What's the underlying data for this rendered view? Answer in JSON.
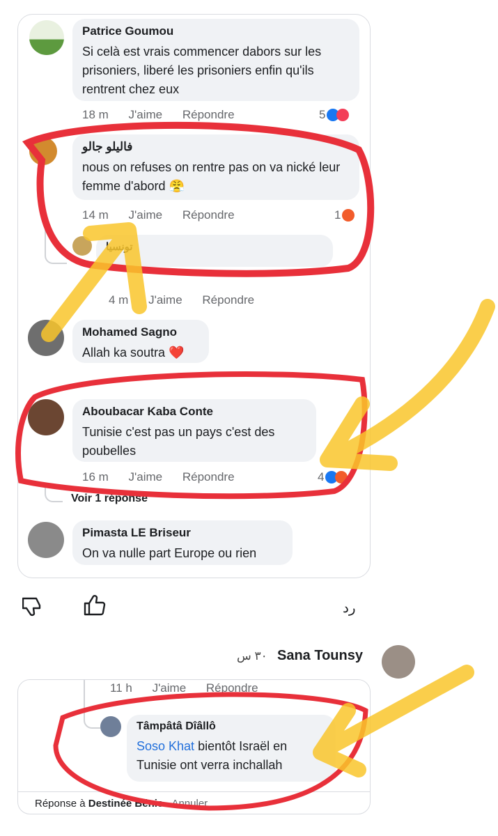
{
  "comments": [
    {
      "author": "Patrice Goumou",
      "text": "Si celà est vrais commencer dabors sur les prisoniers, liberé les prisoniers enfin qu'ils rentrent chez eux",
      "time": "18 m",
      "like": "J'aime",
      "reply": "Répondre",
      "reaction_count": "5"
    },
    {
      "author": "فاليلو جالو",
      "text": "nous on refuses on rentre pas on va nické leur femme d'abord 😤",
      "time": "14 m",
      "like": "J'aime",
      "reply": "Répondre",
      "reaction_count": "1"
    },
    {
      "author": "تونسيا",
      "time": "4 m",
      "like": "J'aime",
      "reply": "Répondre"
    },
    {
      "author": "Mohamed Sagno",
      "text": "Allah ka soutra ❤️"
    },
    {
      "author": "Aboubacar Kaba Conte",
      "text": "Tunisie c'est pas un pays c'est des poubelles",
      "time": "16 m",
      "like": "J'aime",
      "reply": "Répondre",
      "reaction_count": "4",
      "view_replies": "Voir 1 réponse"
    },
    {
      "author": "Pimasta LE Briseur",
      "text": "On va nulle part Europe ou rien"
    }
  ],
  "actions": {
    "reply_ar": "رد"
  },
  "second": {
    "name": "Sana Tounsy",
    "time": "٣٠ س",
    "meta_time": "11 h",
    "meta_like": "J'aime",
    "meta_reply": "Répondre",
    "reply_author": "Tâmpâtâ Dîâllô",
    "mention": "Soso Khat",
    "reply_text": "bientôt Israël en Tunisie ont verra inchallah",
    "replying_to_label": "Réponse à",
    "replying_to": "Destinée Bénie",
    "cancel": "Annuler"
  },
  "colors": {
    "accent": "#216fdb",
    "circle_red": "#e8303a",
    "arrow_yellow": "#f9c62b"
  }
}
